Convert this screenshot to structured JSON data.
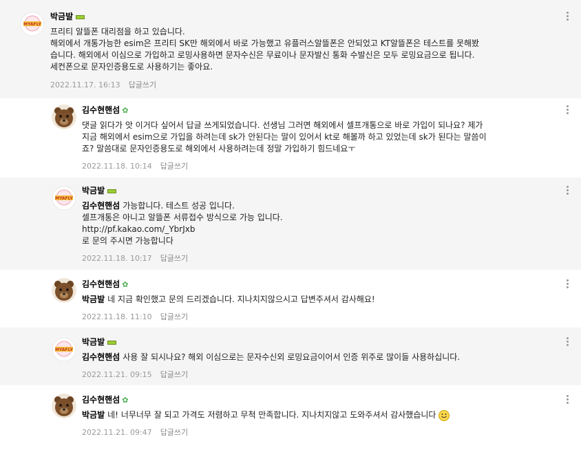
{
  "comments": [
    {
      "author": "박금발",
      "lines": [
        "프리티 알뜰폰 대리점을 하고 있습니다.",
        "해외에서 개통가능한 esim은 프리티 SK만 해외에서 바로 가능했고 유플러스알뜰폰은 안되었고 KT알뜰폰은 테스트를 못해봤",
        "습니다. 해외에서 이심으로 가입하고 로밍사용하면 문자수신은 무료이나 문자발신 통화 수발신은 모두 로밍요금으로 됩니다.",
        "세컨폰으로 문자인증용도로 사용하기는 좋아요."
      ],
      "date": "2022.11.17. 16:13",
      "reply_label": "답글쓰기"
    },
    {
      "author": "김수현핸섬",
      "lines": [
        "댓글 읽다가 앗 이거다 싶어서 답글 쓰게되었습니다. 선생님 그러면 해외에서 셀프개통으로 바로 가입이 되나요? 제가",
        "지금 해외에서 esim으로 가입을 하려는데 sk가 안된다는 말이 있어서 kt로 해볼까 하고 있었는데 sk가 된다는 말씀이",
        "죠? 말씀대로 문자인증용도로 해외에서 사용하려는데 정말 가입하기 힘드네요ㅜ"
      ],
      "date": "2022.11.18. 10:14",
      "reply_label": "답글쓰기"
    },
    {
      "author": "박금발",
      "mention": "김수현핸섬",
      "lines": [
        "가능합니다. 테스트 성공 입니다.",
        "셀프개통은 아니고 알뜰폰 서류접수 방식으로 가능 입니다.",
        "http://pf.kakao.com/_YbrJxb",
        "로 문의 주시면 가능합니다"
      ],
      "date": "2022.11.18. 10:17",
      "reply_label": "답글쓰기"
    },
    {
      "author": "김수현핸섬",
      "mention": "박금발",
      "lines": [
        "네 지금 확인했고 문의 드리겠습니다. 지나치지않으시고 답변주셔서 감사해요!"
      ],
      "date": "2022.11.18. 11:10",
      "reply_label": "답글쓰기"
    },
    {
      "author": "박금발",
      "mention": "김수현핸섬",
      "lines": [
        "사용 잘 되시나요? 해외 이심으로는 문자수신외 로밍요금이어서 인증 위주로 많이들 사용하십니다."
      ],
      "date": "2022.11.21. 09:15",
      "reply_label": "답글쓰기"
    },
    {
      "author": "김수현핸섬",
      "mention": "박금발",
      "lines": [
        "네! 너무너무 잘 되고 가격도 저렴하고 무척 만족합니다. 지나치지않고 도와주셔서 감사했습니다"
      ],
      "date": "2022.11.21. 09:47",
      "reply_label": "답글쓰기"
    }
  ],
  "logo_text": "MYAFLY",
  "icons": {
    "more": "more-vertical-icon",
    "sprout": "sprout-icon",
    "badge": "level-badge-icon",
    "emoji": "smile-emoji-icon"
  }
}
